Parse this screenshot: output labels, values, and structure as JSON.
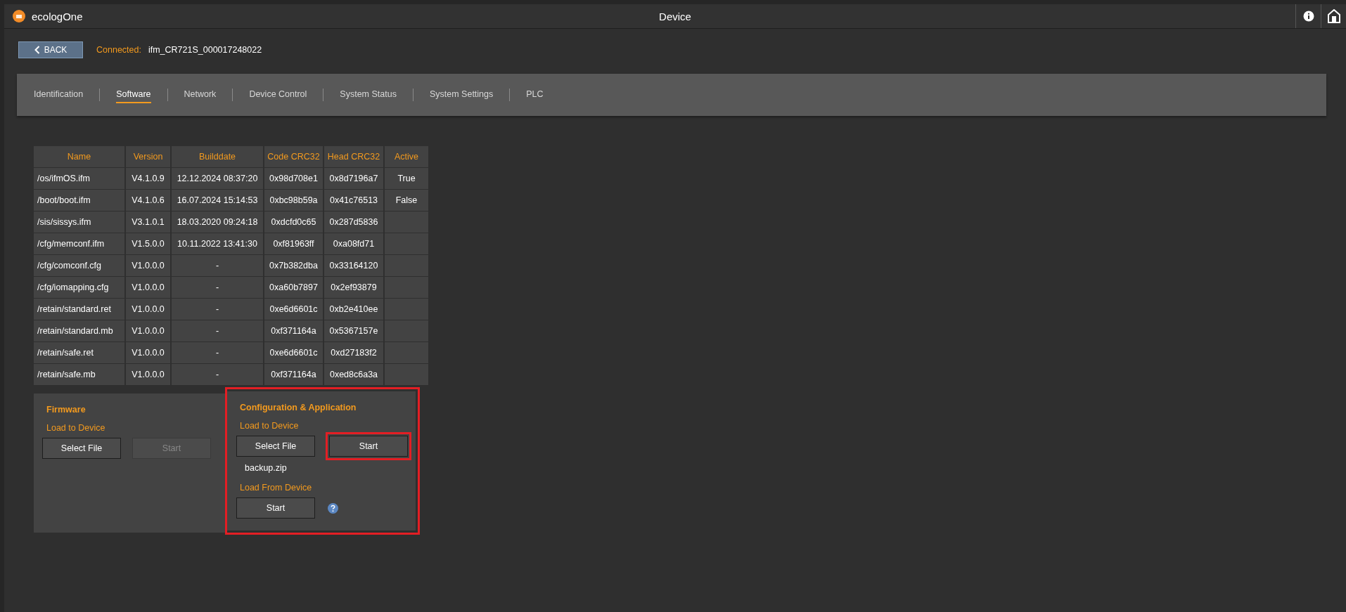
{
  "app": {
    "name": "ecologOne"
  },
  "window": {
    "title": "Device"
  },
  "toolbar": {
    "back_label": "BACK",
    "connected_label": "Connected:",
    "device": "ifm_CR721S_000017248022"
  },
  "tabs": [
    {
      "label": "Identification",
      "selected": false
    },
    {
      "label": "Software",
      "selected": true
    },
    {
      "label": "Network",
      "selected": false
    },
    {
      "label": "Device Control",
      "selected": false
    },
    {
      "label": "System Status",
      "selected": false
    },
    {
      "label": "System Settings",
      "selected": false
    },
    {
      "label": "PLC",
      "selected": false
    }
  ],
  "table": {
    "columns": [
      "Name",
      "Version",
      "Builddate",
      "Code CRC32",
      "Head CRC32",
      "Active"
    ],
    "rows": [
      [
        "/os/ifmOS.ifm",
        "V4.1.0.9",
        "12.12.2024 08:37:20",
        "0x98d708e1",
        "0x8d7196a7",
        "True"
      ],
      [
        "/boot/boot.ifm",
        "V4.1.0.6",
        "16.07.2024 15:14:53",
        "0xbc98b59a",
        "0x41c76513",
        "False"
      ],
      [
        "/sis/sissys.ifm",
        "V3.1.0.1",
        "18.03.2020 09:24:18",
        "0xdcfd0c65",
        "0x287d5836",
        ""
      ],
      [
        "/cfg/memconf.ifm",
        "V1.5.0.0",
        "10.11.2022 13:41:30",
        "0xf81963ff",
        "0xa08fd71",
        ""
      ],
      [
        "/cfg/comconf.cfg",
        "V1.0.0.0",
        "-",
        "0x7b382dba",
        "0x33164120",
        ""
      ],
      [
        "/cfg/iomapping.cfg",
        "V1.0.0.0",
        "-",
        "0xa60b7897",
        "0x2ef93879",
        ""
      ],
      [
        "/retain/standard.ret",
        "V1.0.0.0",
        "-",
        "0xe6d6601c",
        "0xb2e410ee",
        ""
      ],
      [
        "/retain/standard.mb",
        "V1.0.0.0",
        "-",
        "0xf371164a",
        "0x5367157e",
        ""
      ],
      [
        "/retain/safe.ret",
        "V1.0.0.0",
        "-",
        "0xe6d6601c",
        "0xd27183f2",
        ""
      ],
      [
        "/retain/safe.mb",
        "V1.0.0.0",
        "-",
        "0xf371164a",
        "0xed8c6a3a",
        ""
      ]
    ]
  },
  "firmware": {
    "title": "Firmware",
    "load_to_label": "Load to Device",
    "select_button": "Select File",
    "start_button": {
      "label": "Start",
      "disabled": true
    }
  },
  "configuration": {
    "title": "Configuration & Application",
    "highlighted": true,
    "load_to_label": "Load to Device",
    "select_button": "Select File",
    "start_button": {
      "label": "Start",
      "disabled": false,
      "highlighted": true
    },
    "file_name": "backup.zip",
    "load_from_label": "Load From Device",
    "load_from_button": "Start"
  }
}
